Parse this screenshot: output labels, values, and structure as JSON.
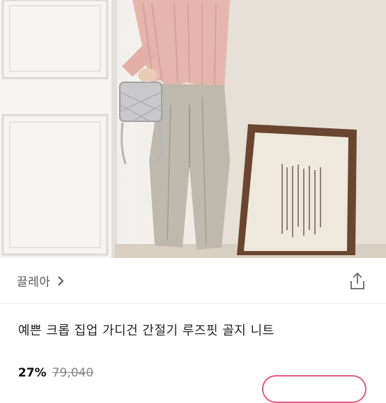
{
  "product_image": {
    "description_icon": "product-photo"
  },
  "seller": {
    "name": "끌레아",
    "chevron_icon": "chevron-right-icon"
  },
  "share": {
    "icon": "share-icon"
  },
  "product": {
    "title": "예쁜 크롭 집업 가디건 간절기 루즈핏 골지 니트"
  },
  "price": {
    "discount": "27%",
    "original": "79,040"
  },
  "colors": {
    "accent": "#e4587f",
    "text": "#222222",
    "muted": "#888888"
  }
}
